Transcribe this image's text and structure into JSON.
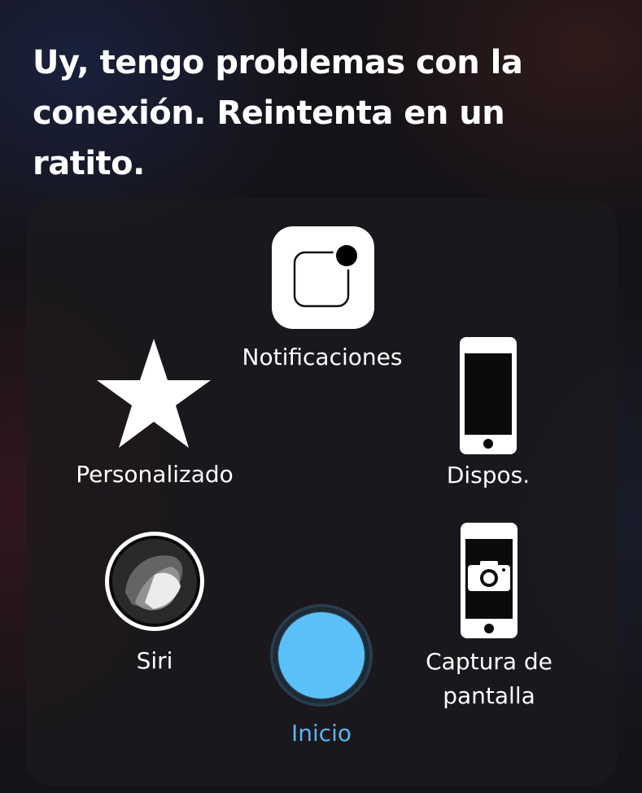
{
  "siri": {
    "message": "Uy, tengo problemas con la conexión. Reintenta en un ratito."
  },
  "assistive_touch": {
    "notifications": {
      "label": "Notificaciones",
      "icon": "notification-icon"
    },
    "custom": {
      "label": "Personalizado",
      "icon": "star-icon"
    },
    "device": {
      "label": "Dispos.",
      "icon": "iphone-icon"
    },
    "siri": {
      "label": "Siri",
      "icon": "siri-icon"
    },
    "screenshot": {
      "label": "Captura de pantalla",
      "icon": "camera-iphone-icon"
    },
    "home": {
      "label": "Inicio",
      "icon": "home-button-icon"
    }
  },
  "colors": {
    "accent": "#5ab4f0",
    "home_button": "#5bc0f8",
    "text": "#ffffff"
  }
}
